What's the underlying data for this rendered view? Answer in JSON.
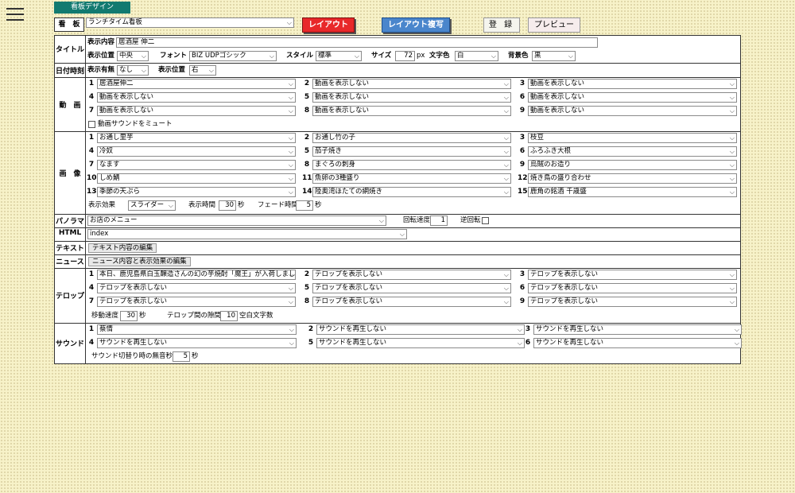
{
  "header": {
    "tab": "看板デザイン",
    "kanban_label": "看　板",
    "kanban_value": "ランチタイム看板",
    "layout_btn": "レイアウト",
    "layout_copy_btn": "レイアウト複写",
    "register_btn": "登 録",
    "preview_btn": "プレビュー"
  },
  "title": {
    "label": "タイトル",
    "content_label": "表示内容",
    "content_value": "居酒屋 伸二",
    "pos_label": "表示位置",
    "pos_value": "中央",
    "font_label": "フォント",
    "font_value": "BIZ UDPゴシック",
    "style_label": "スタイル",
    "style_value": "標準",
    "size_label": "サイズ",
    "size_value": "72",
    "size_unit": "px",
    "fg_label": "文字色",
    "fg_value": "白",
    "bg_label": "背景色",
    "bg_value": "黒"
  },
  "datetime": {
    "label": "日付時刻",
    "show_label": "表示有無",
    "show_value": "なし",
    "pos_label": "表示位置",
    "pos_value": "右"
  },
  "video": {
    "label": "動　画",
    "items": [
      "居酒屋伸二",
      "動画を表示しない",
      "動画を表示しない",
      "動画を表示しない",
      "動画を表示しない",
      "動画を表示しない",
      "動画を表示しない",
      "動画を表示しない",
      "動画を表示しない"
    ],
    "mute_label": "動画サウンドをミュート"
  },
  "image": {
    "label": "画　像",
    "items": [
      "お通し里芋",
      "お通し竹の子",
      "枝豆",
      "冷奴",
      "茄子焼き",
      "ふろふき大根",
      "なます",
      "まぐろの刺身",
      "烏賊のお造り",
      "しめ鯖",
      "魚卵の3種盛り",
      "焼き鳥の盛り合わせ",
      "季節の天ぷら",
      "陸奥湾ほたての網焼き",
      "鹿角の銘酒 千歳盛"
    ],
    "effect_label": "表示効果",
    "effect_value": "スライダー",
    "time_label": "表示時間",
    "time_value": "30",
    "time_unit": "秒",
    "fade_label": "フェード時間",
    "fade_value": "5",
    "fade_unit": "秒"
  },
  "panorama": {
    "label": "パノラマ",
    "value": "お店のメニュー",
    "speed_label": "回転速度",
    "speed_value": "1",
    "reverse_label": "逆回転"
  },
  "html": {
    "label": "HTML",
    "value": "index"
  },
  "text": {
    "label": "テキスト",
    "button": "テキスト内容の編集"
  },
  "news": {
    "label": "ニュース",
    "button": "ニュース内容と表示効果の編集"
  },
  "telop": {
    "label": "テロップ",
    "items": [
      "本日、鹿児島県白玉醸造さんの幻の芋焼酎「魔王」が入荷しました。お",
      "テロップを表示しない",
      "テロップを表示しない",
      "テロップを表示しない",
      "テロップを表示しない",
      "テロップを表示しない",
      "テロップを表示しない",
      "テロップを表示しない",
      "テロップを表示しない"
    ],
    "speed_label": "移動速度",
    "speed_value": "30",
    "speed_unit": "秒",
    "gap_label": "テロップ間の隙間",
    "gap_value": "10",
    "gap_unit": "空白文字数"
  },
  "sound": {
    "label": "サウンド",
    "items": [
      "蔡情",
      "サウンドを再生しない",
      "サウンドを再生しない",
      "サウンドを再生しない",
      "サウンドを再生しない",
      "サウンドを再生しない"
    ],
    "silence_label": "サウンド切替り時の無音秒数",
    "silence_value": "5",
    "silence_unit": "秒"
  }
}
